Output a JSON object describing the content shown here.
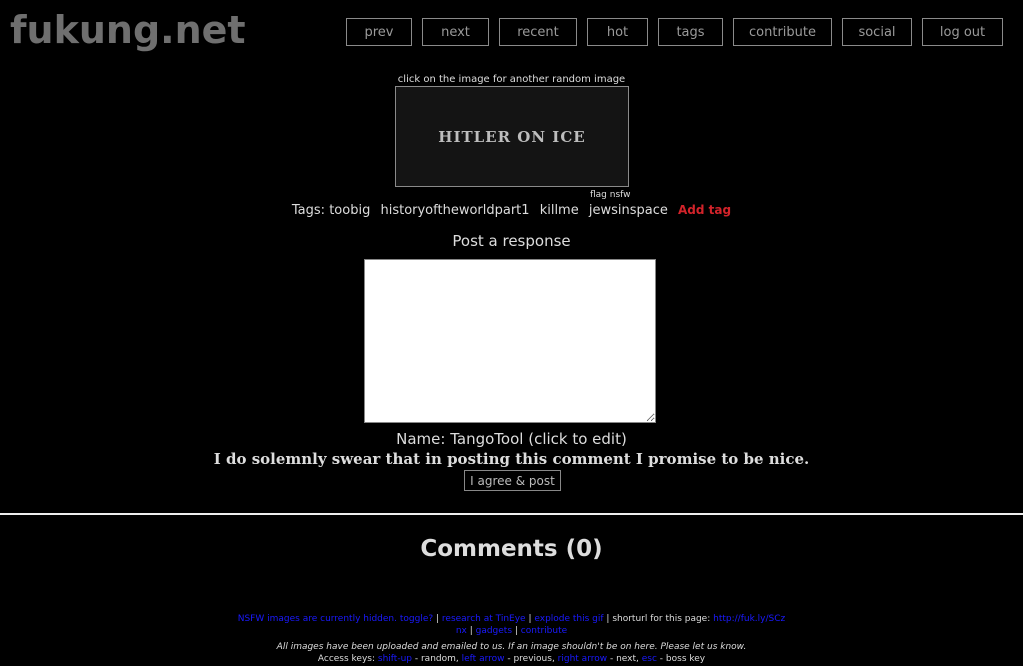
{
  "site": {
    "logo": "fukung.net"
  },
  "nav": [
    {
      "label": "prev"
    },
    {
      "label": "next"
    },
    {
      "label": "recent"
    },
    {
      "label": "hot"
    },
    {
      "label": "tags"
    },
    {
      "label": "contribute"
    },
    {
      "label": "social"
    },
    {
      "label": "log out"
    }
  ],
  "image": {
    "hint": "click on the image for another random image",
    "caption": "HITLER ON ICE",
    "flag": "flag nsfw"
  },
  "tags": {
    "label": "Tags:",
    "items": [
      "toobig",
      "historyoftheworldpart1",
      "killme",
      "jewsinspace"
    ],
    "add_label": "Add tag"
  },
  "response": {
    "heading": "Post a response",
    "text": "",
    "name_prefix": "Name:",
    "name": "TangoTool (click to edit)",
    "swear": "I do solemnly swear that in posting this comment I promise to be nice.",
    "submit_label": "I agree & post"
  },
  "comments": {
    "heading": "Comments (0)"
  },
  "footer": {
    "nsfw_toggle": "NSFW images are currently hidden. toggle?",
    "research": "research at TinEye",
    "explode": "explode this gif",
    "shorturl_label": "shorturl for this page:",
    "shorturl_a": "http://fuk.ly/SCz",
    "shorturl_b": "nx",
    "gadgets": "gadgets",
    "contribute": "contribute",
    "note": "All images have been uploaded and emailed to us. If an image shouldn't be on here. Please let us know.",
    "access_label": "Access keys:",
    "keys": [
      {
        "key": "shift-up",
        "action": " - random, "
      },
      {
        "key": "left arrow",
        "action": " - previous, "
      },
      {
        "key": "right arrow",
        "action": " - next, "
      },
      {
        "key": "esc",
        "action": " - boss key"
      }
    ],
    "sep": " | "
  },
  "colors": {
    "background": "#000000",
    "logo": "#6f6f6f",
    "add_tag": "#d2232a",
    "footer_link": "#1a1aff"
  }
}
